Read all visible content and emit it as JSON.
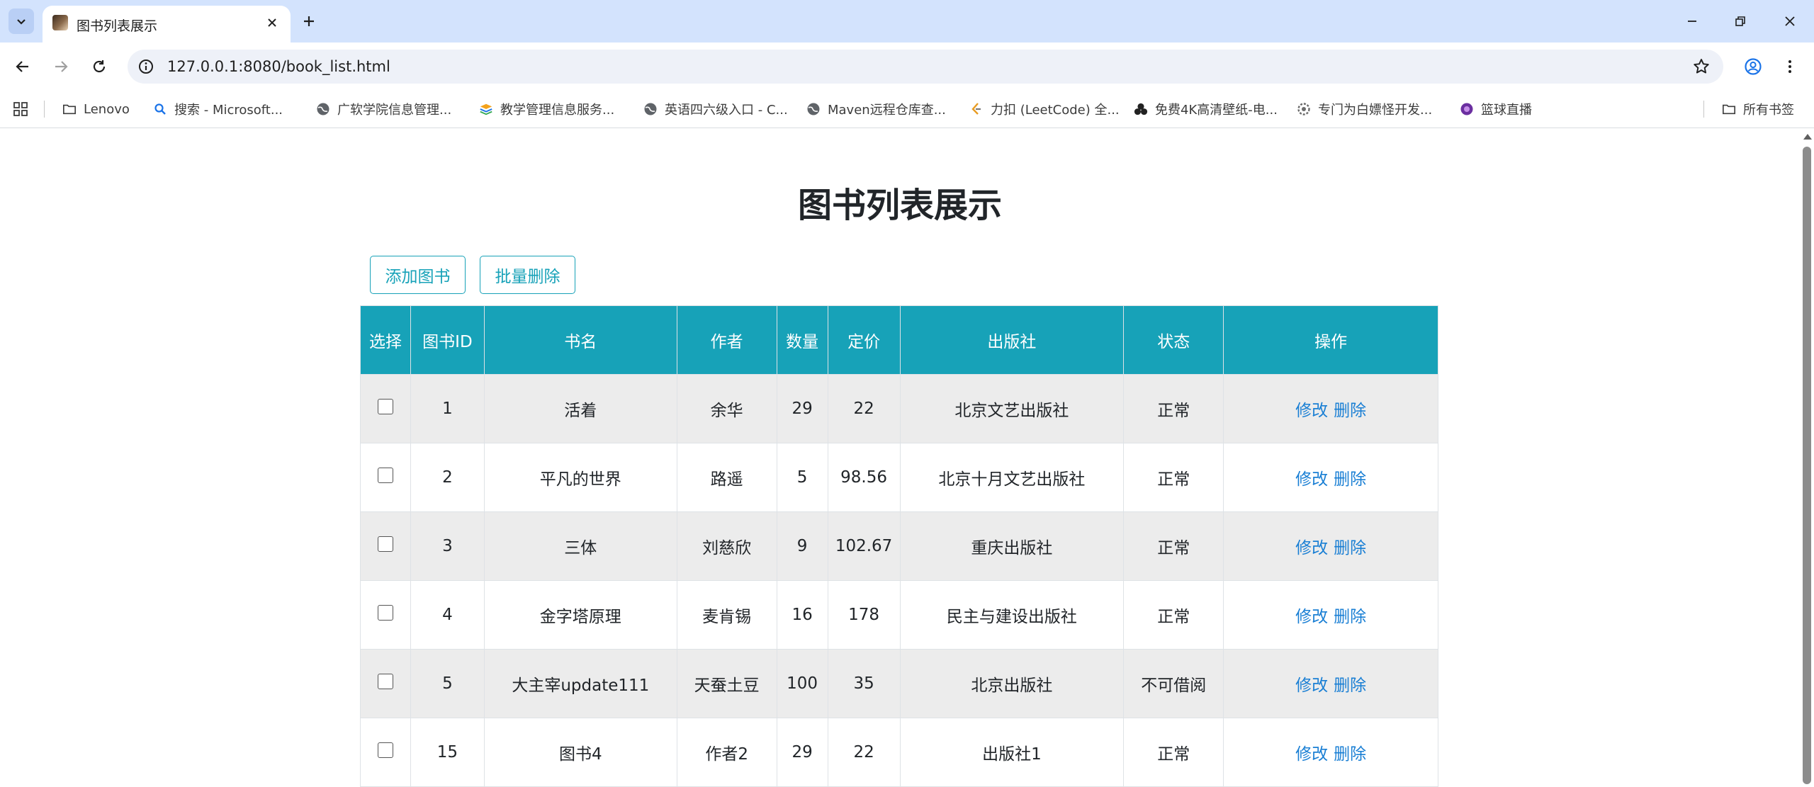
{
  "browser": {
    "tab_title": "图书列表展示",
    "url": "127.0.0.1:8080/book_list.html",
    "bookmarks": [
      {
        "label": "Lenovo",
        "icon": "folder-icon"
      },
      {
        "label": "搜索 - Microsoft...",
        "icon": "search-icon"
      },
      {
        "label": "广软学院信息管理...",
        "icon": "globe-icon"
      },
      {
        "label": "教学管理信息服务...",
        "icon": "stack-icon"
      },
      {
        "label": "英语四六级入口 - C...",
        "icon": "globe-icon"
      },
      {
        "label": "Maven远程仓库查...",
        "icon": "globe-icon"
      },
      {
        "label": "力扣 (LeetCode) 全...",
        "icon": "leetcode-icon"
      },
      {
        "label": "免费4K高清壁纸-电...",
        "icon": "cluster-icon"
      },
      {
        "label": "专门为白嫖怪开发...",
        "icon": "gear-icon"
      },
      {
        "label": "篮球直播",
        "icon": "ball-icon"
      }
    ],
    "all_bookmarks_label": "所有书签"
  },
  "page": {
    "title": "图书列表展示",
    "add_button": "添加图书",
    "batch_delete_button": "批量删除",
    "columns": [
      "选择",
      "图书ID",
      "书名",
      "作者",
      "数量",
      "定价",
      "出版社",
      "状态",
      "操作"
    ],
    "rows": [
      {
        "id": "1",
        "name": "活着",
        "author": "余华",
        "count": "29",
        "price": "22",
        "publisher": "北京文艺出版社",
        "status": "正常"
      },
      {
        "id": "2",
        "name": "平凡的世界",
        "author": "路遥",
        "count": "5",
        "price": "98.56",
        "publisher": "北京十月文艺出版社",
        "status": "正常"
      },
      {
        "id": "3",
        "name": "三体",
        "author": "刘慈欣",
        "count": "9",
        "price": "102.67",
        "publisher": "重庆出版社",
        "status": "正常"
      },
      {
        "id": "4",
        "name": "金字塔原理",
        "author": "麦肯锡",
        "count": "16",
        "price": "178",
        "publisher": "民主与建设出版社",
        "status": "正常"
      },
      {
        "id": "5",
        "name": "大主宰update111",
        "author": "天蚕土豆",
        "count": "100",
        "price": "35",
        "publisher": "北京出版社",
        "status": "不可借阅"
      },
      {
        "id": "15",
        "name": "图书4",
        "author": "作者2",
        "count": "29",
        "price": "22",
        "publisher": "出版社1",
        "status": "正常"
      }
    ],
    "edit_label": "修改",
    "delete_label": "删除"
  },
  "colors": {
    "accent": "#17a2b8",
    "link": "#1a7fd4",
    "tabstrip": "#d3e3fd"
  }
}
